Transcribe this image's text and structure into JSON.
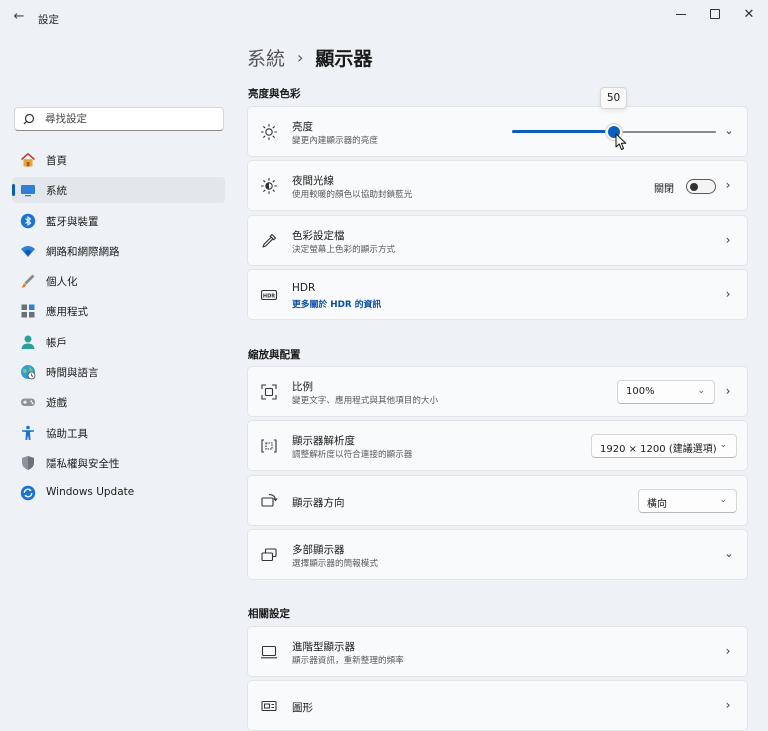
{
  "window": {
    "title": "設定"
  },
  "sidebar": {
    "search_placeholder": "尋找設定",
    "items": [
      {
        "label": "首頁",
        "icon": "home-icon"
      },
      {
        "label": "系統",
        "icon": "system-icon",
        "selected": true
      },
      {
        "label": "藍牙與裝置",
        "icon": "bluetooth-icon"
      },
      {
        "label": "網路和網際網路",
        "icon": "wifi-icon"
      },
      {
        "label": "個人化",
        "icon": "brush-icon"
      },
      {
        "label": "應用程式",
        "icon": "apps-icon"
      },
      {
        "label": "帳戶",
        "icon": "account-icon"
      },
      {
        "label": "時間與語言",
        "icon": "globe-icon"
      },
      {
        "label": "遊戲",
        "icon": "gamepad-icon"
      },
      {
        "label": "協助工具",
        "icon": "accessibility-icon"
      },
      {
        "label": "隱私權與安全性",
        "icon": "shield-icon"
      },
      {
        "label": "Windows Update",
        "icon": "update-icon"
      }
    ]
  },
  "breadcrumb": {
    "parent": "系統",
    "separator": "›",
    "current": "顯示器"
  },
  "sections": {
    "brightness": {
      "title": "亮度與色彩",
      "brightness": {
        "title": "亮度",
        "subtitle": "變更內建顯示器的亮度",
        "value": 50,
        "tooltip": "50"
      },
      "night_light": {
        "title": "夜間光線",
        "subtitle": "使用較暖的顏色以協助封鎖藍光",
        "toggle_label": "關閉",
        "toggle_on": false
      },
      "color_profile": {
        "title": "色彩設定檔",
        "subtitle": "決定螢幕上色彩的顯示方式"
      },
      "hdr": {
        "title": "HDR",
        "link": "更多關於 HDR 的資訊"
      }
    },
    "scale_layout": {
      "title": "縮放與配置",
      "scale": {
        "title": "比例",
        "subtitle": "變更文字、應用程式與其他項目的大小",
        "value": "100%"
      },
      "resolution": {
        "title": "顯示器解析度",
        "subtitle": "調整解析度以符合連接的顯示器",
        "value": "1920 × 1200 (建議選項)"
      },
      "orientation": {
        "title": "顯示器方向",
        "value": "橫向"
      },
      "multiple": {
        "title": "多部顯示器",
        "subtitle": "選擇顯示器的簡報模式"
      }
    },
    "related": {
      "title": "相關設定",
      "advanced": {
        "title": "進階型顯示器",
        "subtitle": "顯示器資訊，重新整理的頻率"
      },
      "graphics": {
        "title": "圖形"
      }
    }
  },
  "colors": {
    "accent": "#0a5fbd",
    "background": "#eef2f6",
    "card": "#f9fafb"
  }
}
